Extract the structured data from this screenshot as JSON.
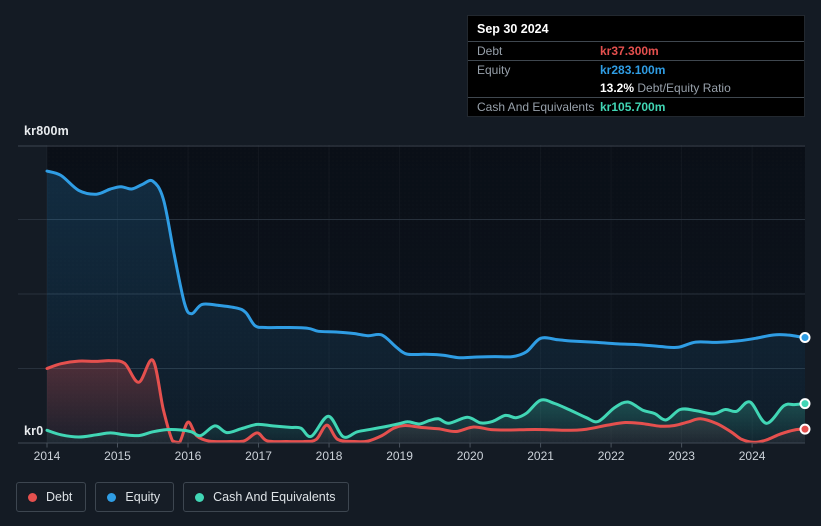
{
  "colors": {
    "debt": "#e5504e",
    "equity": "#2f9de4",
    "cash": "#41d6b5",
    "page_bg": "#141b24",
    "plot_bg_top": "#0a0f17",
    "plot_bg_bottom": "#0d141d",
    "grid": "#28313c",
    "grid_top": "#3d4651",
    "axis": "#3f4954",
    "tick": "#49525d",
    "tooltip_bg": "#000000"
  },
  "tooltip": {
    "date": "Sep 30 2024",
    "debt_label": "Debt",
    "debt_value": "kr37.300m",
    "equity_label": "Equity",
    "equity_value": "kr283.100m",
    "ratio_value": "13.2%",
    "ratio_label": "Debt/Equity Ratio",
    "cash_label": "Cash And Equivalents",
    "cash_value": "kr105.700m"
  },
  "legend": {
    "items": [
      {
        "label": "Debt",
        "color": "#e5504e"
      },
      {
        "label": "Equity",
        "color": "#2f9de4"
      },
      {
        "label": "Cash And Equivalents",
        "color": "#41d6b5"
      }
    ]
  },
  "chart_data": {
    "type": "area",
    "y_top_label": "kr800m",
    "y_bottom_label": "kr0",
    "ylim": [
      0,
      800
    ],
    "grid_values": [
      800,
      600,
      400,
      200
    ],
    "x_domain": [
      2014,
      2024.75
    ],
    "x_ticks": [
      2014,
      2015,
      2016,
      2017,
      2018,
      2019,
      2020,
      2021,
      2022,
      2023,
      2024
    ],
    "unit": "kr millions",
    "series": [
      {
        "name": "Debt",
        "color": "#e5504e",
        "end_value": 37.3,
        "points": [
          [
            2014,
            200
          ],
          [
            2014.2,
            213
          ],
          [
            2014.45,
            220
          ],
          [
            2014.7,
            219
          ],
          [
            2014.9,
            221
          ],
          [
            2015.1,
            214
          ],
          [
            2015.3,
            163
          ],
          [
            2015.5,
            222
          ],
          [
            2015.65,
            90
          ],
          [
            2015.78,
            6
          ],
          [
            2015.88,
            2
          ],
          [
            2016,
            56
          ],
          [
            2016.12,
            20
          ],
          [
            2016.3,
            5
          ],
          [
            2016.6,
            4
          ],
          [
            2016.8,
            6
          ],
          [
            2016.98,
            27
          ],
          [
            2017.12,
            6
          ],
          [
            2017.4,
            4
          ],
          [
            2017.65,
            4
          ],
          [
            2017.82,
            10
          ],
          [
            2017.97,
            48
          ],
          [
            2018.12,
            10
          ],
          [
            2018.35,
            4
          ],
          [
            2018.55,
            5
          ],
          [
            2018.75,
            20
          ],
          [
            2018.92,
            40
          ],
          [
            2019.08,
            47
          ],
          [
            2019.3,
            42
          ],
          [
            2019.55,
            38
          ],
          [
            2019.8,
            31
          ],
          [
            2020.05,
            43
          ],
          [
            2020.3,
            36
          ],
          [
            2020.55,
            35
          ],
          [
            2020.8,
            36
          ],
          [
            2021.05,
            36
          ],
          [
            2021.35,
            34
          ],
          [
            2021.65,
            37
          ],
          [
            2021.95,
            48
          ],
          [
            2022.2,
            55
          ],
          [
            2022.45,
            52
          ],
          [
            2022.7,
            45
          ],
          [
            2022.9,
            47
          ],
          [
            2023.1,
            57
          ],
          [
            2023.27,
            65
          ],
          [
            2023.5,
            52
          ],
          [
            2023.7,
            30
          ],
          [
            2023.85,
            10
          ],
          [
            2024.02,
            2
          ],
          [
            2024.2,
            8
          ],
          [
            2024.4,
            24
          ],
          [
            2024.6,
            35
          ],
          [
            2024.75,
            37.3
          ]
        ]
      },
      {
        "name": "Equity",
        "color": "#2f9de4",
        "end_value": 283.1,
        "points": [
          [
            2014,
            730
          ],
          [
            2014.2,
            718
          ],
          [
            2014.45,
            678
          ],
          [
            2014.7,
            668
          ],
          [
            2014.9,
            682
          ],
          [
            2015.05,
            688
          ],
          [
            2015.2,
            682
          ],
          [
            2015.35,
            694
          ],
          [
            2015.5,
            703
          ],
          [
            2015.65,
            655
          ],
          [
            2015.8,
            510
          ],
          [
            2015.95,
            375
          ],
          [
            2016.05,
            347
          ],
          [
            2016.2,
            372
          ],
          [
            2016.45,
            369
          ],
          [
            2016.7,
            362
          ],
          [
            2016.82,
            350
          ],
          [
            2016.95,
            315
          ],
          [
            2017.1,
            310
          ],
          [
            2017.4,
            310
          ],
          [
            2017.7,
            308
          ],
          [
            2017.85,
            300
          ],
          [
            2018.1,
            298
          ],
          [
            2018.35,
            294
          ],
          [
            2018.55,
            288
          ],
          [
            2018.75,
            290
          ],
          [
            2018.95,
            258
          ],
          [
            2019.1,
            239
          ],
          [
            2019.35,
            238
          ],
          [
            2019.6,
            236
          ],
          [
            2019.85,
            229
          ],
          [
            2020.1,
            231
          ],
          [
            2020.35,
            232
          ],
          [
            2020.6,
            232
          ],
          [
            2020.8,
            245
          ],
          [
            2021,
            281
          ],
          [
            2021.25,
            277
          ],
          [
            2021.5,
            273
          ],
          [
            2021.8,
            270
          ],
          [
            2022.1,
            266
          ],
          [
            2022.4,
            264
          ],
          [
            2022.7,
            259
          ],
          [
            2022.95,
            257
          ],
          [
            2023.2,
            271
          ],
          [
            2023.5,
            270
          ],
          [
            2023.8,
            274
          ],
          [
            2024.05,
            281
          ],
          [
            2024.3,
            290
          ],
          [
            2024.5,
            290
          ],
          [
            2024.65,
            286
          ],
          [
            2024.75,
            283.1
          ]
        ]
      },
      {
        "name": "Cash And Equivalents",
        "color": "#41d6b5",
        "end_value": 105.7,
        "points": [
          [
            2014,
            34
          ],
          [
            2014.2,
            22
          ],
          [
            2014.45,
            16
          ],
          [
            2014.7,
            22
          ],
          [
            2014.9,
            27
          ],
          [
            2015.1,
            22
          ],
          [
            2015.3,
            20
          ],
          [
            2015.5,
            30
          ],
          [
            2015.7,
            36
          ],
          [
            2015.9,
            35
          ],
          [
            2016.05,
            30
          ],
          [
            2016.18,
            20
          ],
          [
            2016.38,
            46
          ],
          [
            2016.55,
            28
          ],
          [
            2016.75,
            38
          ],
          [
            2016.98,
            50
          ],
          [
            2017.2,
            46
          ],
          [
            2017.45,
            42
          ],
          [
            2017.6,
            40
          ],
          [
            2017.75,
            18
          ],
          [
            2017.99,
            72
          ],
          [
            2018.2,
            17
          ],
          [
            2018.4,
            30
          ],
          [
            2018.6,
            37
          ],
          [
            2018.8,
            44
          ],
          [
            2019,
            52
          ],
          [
            2019.12,
            57
          ],
          [
            2019.28,
            51
          ],
          [
            2019.42,
            60
          ],
          [
            2019.55,
            65
          ],
          [
            2019.7,
            53
          ],
          [
            2019.96,
            69
          ],
          [
            2020.15,
            54
          ],
          [
            2020.32,
            58
          ],
          [
            2020.5,
            74
          ],
          [
            2020.65,
            68
          ],
          [
            2020.8,
            80
          ],
          [
            2021,
            115
          ],
          [
            2021.2,
            106
          ],
          [
            2021.4,
            90
          ],
          [
            2021.65,
            68
          ],
          [
            2021.82,
            58
          ],
          [
            2022.05,
            95
          ],
          [
            2022.24,
            110
          ],
          [
            2022.45,
            88
          ],
          [
            2022.62,
            79
          ],
          [
            2022.78,
            62
          ],
          [
            2022.98,
            90
          ],
          [
            2023.2,
            87
          ],
          [
            2023.45,
            78
          ],
          [
            2023.62,
            90
          ],
          [
            2023.78,
            85
          ],
          [
            2023.97,
            110
          ],
          [
            2024.2,
            53
          ],
          [
            2024.45,
            100
          ],
          [
            2024.6,
            103
          ],
          [
            2024.75,
            105.7
          ]
        ]
      }
    ]
  }
}
